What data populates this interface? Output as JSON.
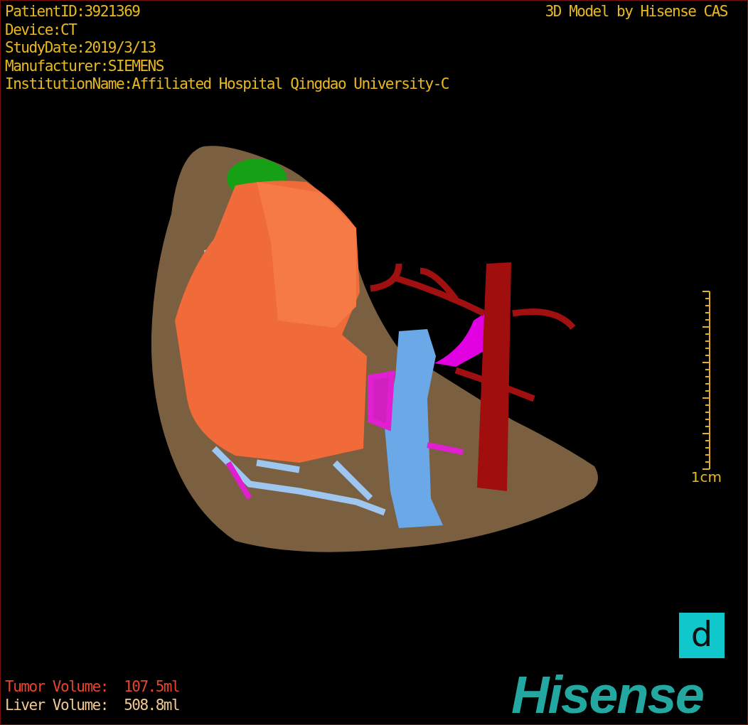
{
  "patient_info": [
    "PatientID:3921369",
    "Device:CT",
    "StudyDate:2019/3/13",
    "Manufacturer:SIEMENS",
    "InstitutionName:Affiliated Hospital Qingdao University-C"
  ],
  "model_credit": "3D Model by Hisense CAS",
  "scale_bar": {
    "label": "1cm"
  },
  "volumes": [
    {
      "kind": "tumor",
      "label": "Tumor Volume:",
      "value": "107.5ml"
    },
    {
      "kind": "liver",
      "label": "Liver Volume:",
      "value": "508.8ml"
    }
  ],
  "badge": "d",
  "logo": "Hisense"
}
